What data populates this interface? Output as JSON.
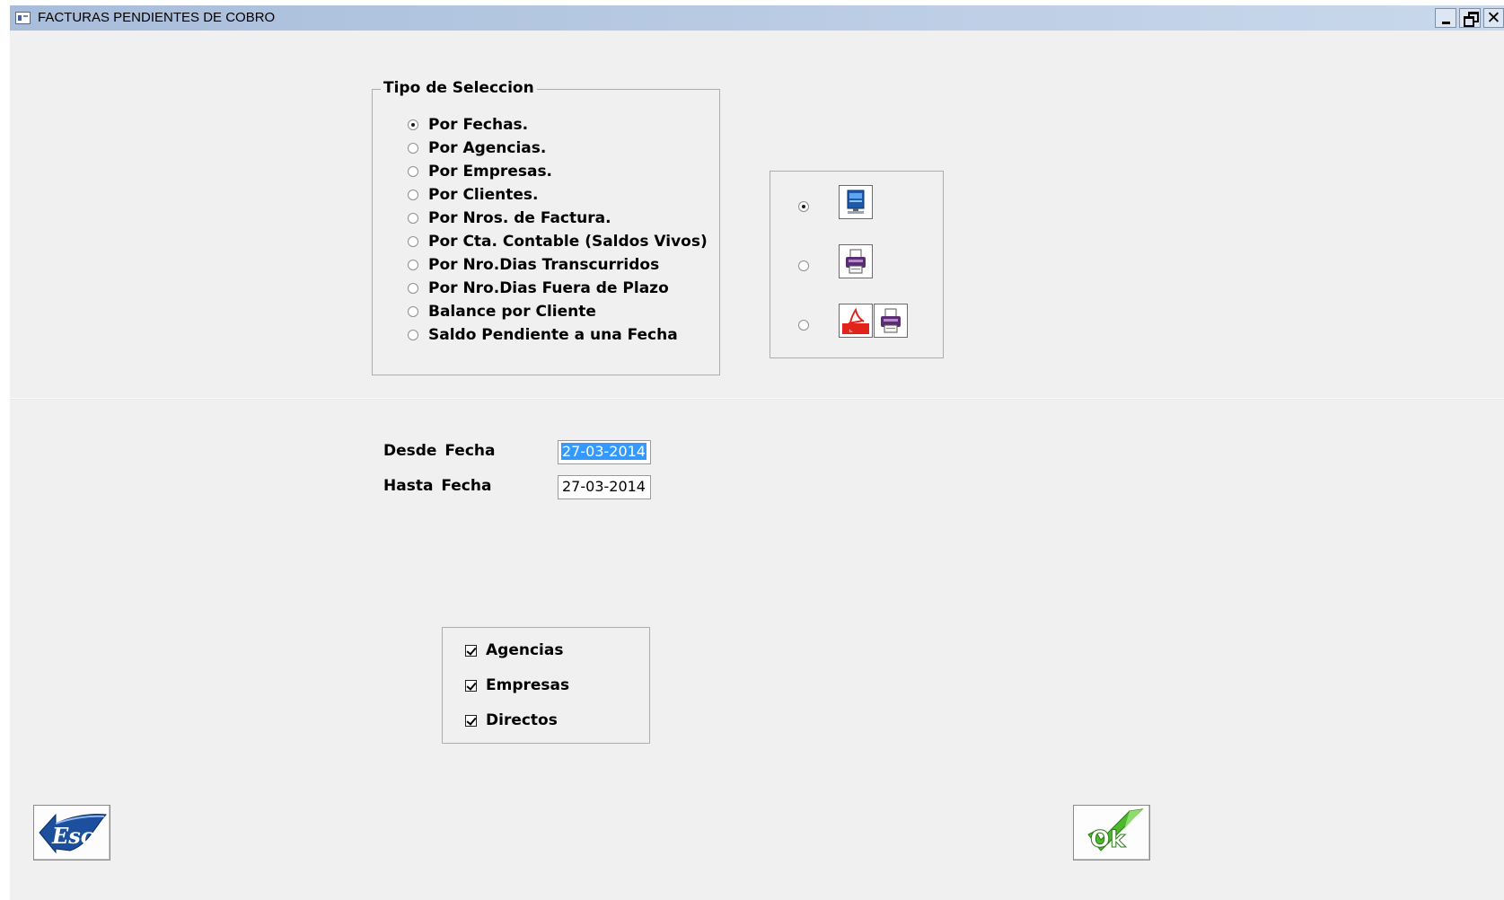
{
  "window": {
    "title": "FACTURAS PENDIENTES DE COBRO",
    "controls": {
      "minimize": "_",
      "restore": "restore",
      "close": "✕"
    }
  },
  "selection_type": {
    "legend": "Tipo de Seleccion",
    "options": [
      {
        "label": "Por Fechas.",
        "checked": true
      },
      {
        "label": "Por Agencias.",
        "checked": false
      },
      {
        "label": "Por Empresas.",
        "checked": false
      },
      {
        "label": "Por Clientes.",
        "checked": false
      },
      {
        "label": "Por Nros. de Factura.",
        "checked": false
      },
      {
        "label": "Por Cta. Contable (Saldos Vivos)",
        "checked": false
      },
      {
        "label": "Por Nro.Dias Transcurridos",
        "checked": false
      },
      {
        "label": "Por Nro.Dias Fuera de Plazo",
        "checked": false
      },
      {
        "label": "Balance por Cliente",
        "checked": false
      },
      {
        "label": "Saldo Pendiente a una Fecha",
        "checked": false
      }
    ]
  },
  "output": {
    "options": [
      {
        "icon": "screen-preview-icon",
        "checked": true
      },
      {
        "icon": "printer-icon",
        "checked": false
      },
      {
        "icon": "pdf-printer-icon",
        "checked": false
      }
    ]
  },
  "dates": {
    "from_label": "Desde  Fecha",
    "from_value": "27-03-2014",
    "to_label": "Hasta  Fecha",
    "to_value": "27-03-2014"
  },
  "filters": {
    "items": [
      {
        "label": "Agencias",
        "checked": true
      },
      {
        "label": "Empresas",
        "checked": true
      },
      {
        "label": "Directos",
        "checked": true
      }
    ]
  },
  "buttons": {
    "esc_text": "Esc",
    "ok_text": "Ok"
  },
  "colors": {
    "selection_highlight": "#3399ff",
    "ok_green": "#4db82e",
    "esc_blue": "#1c4f9e",
    "pdf_red": "#e2231a"
  }
}
